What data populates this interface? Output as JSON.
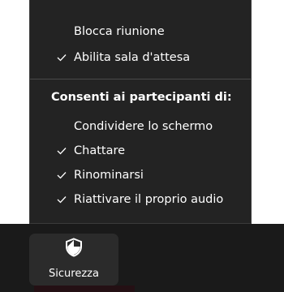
{
  "menu": {
    "items": [
      {
        "label": "Blocca riunione",
        "checked": false
      },
      {
        "label": "Abilita sala d'attesa",
        "checked": true
      }
    ],
    "section_title": "Consenti ai partecipanti di:",
    "participant_items": [
      {
        "label": "Condividere lo schermo",
        "checked": false
      },
      {
        "label": "Chattare",
        "checked": true
      },
      {
        "label": "Rinominarsi",
        "checked": true
      },
      {
        "label": "Riattivare il proprio audio",
        "checked": true
      }
    ]
  },
  "toolbar": {
    "security_button": {
      "label": "Sicurezza",
      "icon": "shield-icon"
    }
  },
  "colors": {
    "menu_background": "#232323",
    "toolbar_background": "#1a1a1a",
    "text": "#ffffff"
  }
}
